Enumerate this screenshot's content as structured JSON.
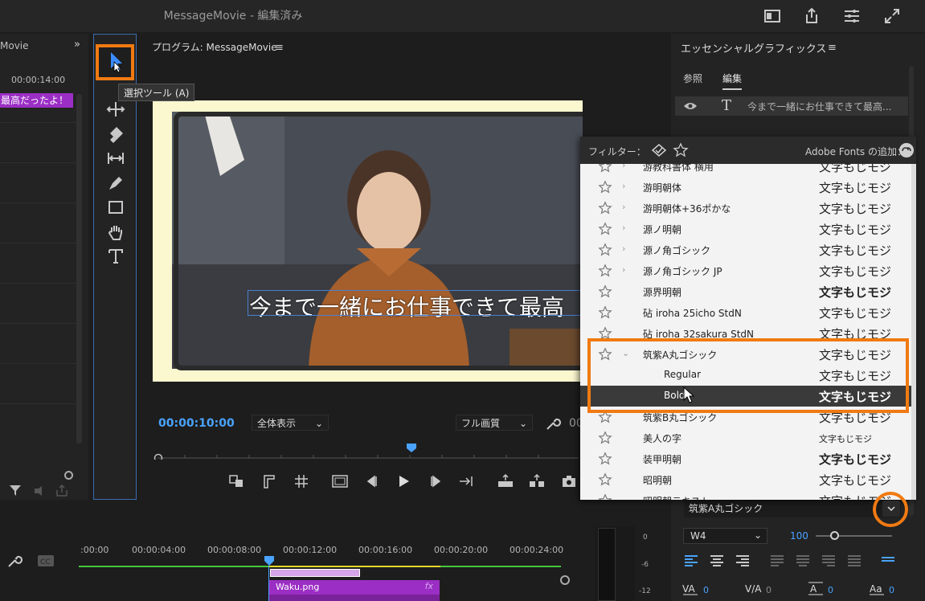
{
  "window": {
    "title": "MessageMovie - 編集済み"
  },
  "project_panel": {
    "title": "Movie",
    "time": "00:00:14:00",
    "clip_label": "最高だったよ！"
  },
  "toolbar": {
    "tooltip": "選択ツール (A)"
  },
  "program": {
    "title": "プログラム: MessageMovie",
    "overlay_text": "今まで一緒にお仕事できて最高",
    "timecode": "00:00:10:00",
    "fit_dropdown": "全体表示",
    "quality_dropdown": "フル画質",
    "duration_partial": "00"
  },
  "font_popup": {
    "filter_label": "フィルター：",
    "adobe_fonts_label": "Adobe Fonts の追加：",
    "fonts": [
      {
        "name": "游教科書体 横用",
        "sample": "文字もじモジ",
        "chevron": "›",
        "starred": false,
        "bold": false,
        "partial": true
      },
      {
        "name": "游明朝体",
        "sample": "文字もじモジ",
        "chevron": "›",
        "starred": false,
        "bold": false
      },
      {
        "name": "游明朝体+36ポかな",
        "sample": "文字もじモジ",
        "chevron": "›",
        "starred": false,
        "bold": false
      },
      {
        "name": "源ノ明朝",
        "sample": "文字もじモジ",
        "chevron": "›",
        "starred": false,
        "bold": false
      },
      {
        "name": "源ノ角ゴシック",
        "sample": "文字もじモジ",
        "chevron": "›",
        "starred": false,
        "bold": false
      },
      {
        "name": "源ノ角ゴシック JP",
        "sample": "文字もじモジ",
        "chevron": "›",
        "starred": false,
        "bold": false
      },
      {
        "name": "源界明朝",
        "sample": "文字もじモジ",
        "chevron": "",
        "starred": false,
        "bold": true
      },
      {
        "name": "砧 iroha 25icho StdN",
        "sample": "文字もじモジ",
        "chevron": "",
        "starred": false,
        "bold": false
      },
      {
        "name": "砧 iroha 32sakura StdN",
        "sample": "文字もじモジ",
        "chevron": "",
        "starred": false,
        "bold": false
      },
      {
        "name": "筑紫A丸ゴシック",
        "sample": "文字もじモジ",
        "chevron": "⌄",
        "starred": false,
        "bold": false
      },
      {
        "name": "Regular",
        "sample": "文字もじモジ",
        "chevron": "",
        "starred": null,
        "bold": false,
        "sub": true
      },
      {
        "name": "Bold",
        "sample": "文字もじモジ",
        "chevron": "",
        "starred": null,
        "bold": true,
        "sub": true,
        "selected": true
      },
      {
        "name": "筑紫B丸ゴシック",
        "sample": "文字もじモジ",
        "chevron": "",
        "starred": false,
        "bold": false
      },
      {
        "name": "美人の字",
        "sample": "文字もじモジ",
        "chevron": "",
        "starred": false,
        "bold": false,
        "script": true
      },
      {
        "name": "装甲明朝",
        "sample": "文字もじモジ",
        "chevron": "",
        "starred": false,
        "bold": true
      },
      {
        "name": "昭明朝",
        "sample": "文字もじモジ",
        "chevron": "",
        "starred": false,
        "bold": false
      },
      {
        "name": "昭明朝テキスト",
        "sample": "文字もじモジ",
        "chevron": "",
        "starred": false,
        "bold": false,
        "partial": true
      }
    ]
  },
  "essential_graphics": {
    "title": "エッセンシャルグラフィックス",
    "tab_browse": "参照",
    "tab_edit": "編集",
    "layer_text": "今まで一緒にお仕事できて最高...",
    "font_value": "筑紫A丸ゴシック",
    "weight_value": "W4",
    "size_value": "100",
    "tracking_values": [
      "0",
      "0",
      "0",
      "0"
    ]
  },
  "timeline": {
    "ruler": [
      ":00:00",
      "00:00:04:00",
      "00:00:08:00",
      "00:00:12:00",
      "00:00:16:00",
      "00:00:20:00",
      "00:00:24:00"
    ],
    "clip_name": "Waku.png",
    "clip_fx": "fx",
    "meter_labels": [
      "0",
      "-6",
      "-12"
    ]
  },
  "colors": {
    "accent_blue": "#4aa3ff",
    "highlight_orange": "#f07a12",
    "clip_purple": "#9b2ec4",
    "popup_bg": "#f3f3f3"
  }
}
